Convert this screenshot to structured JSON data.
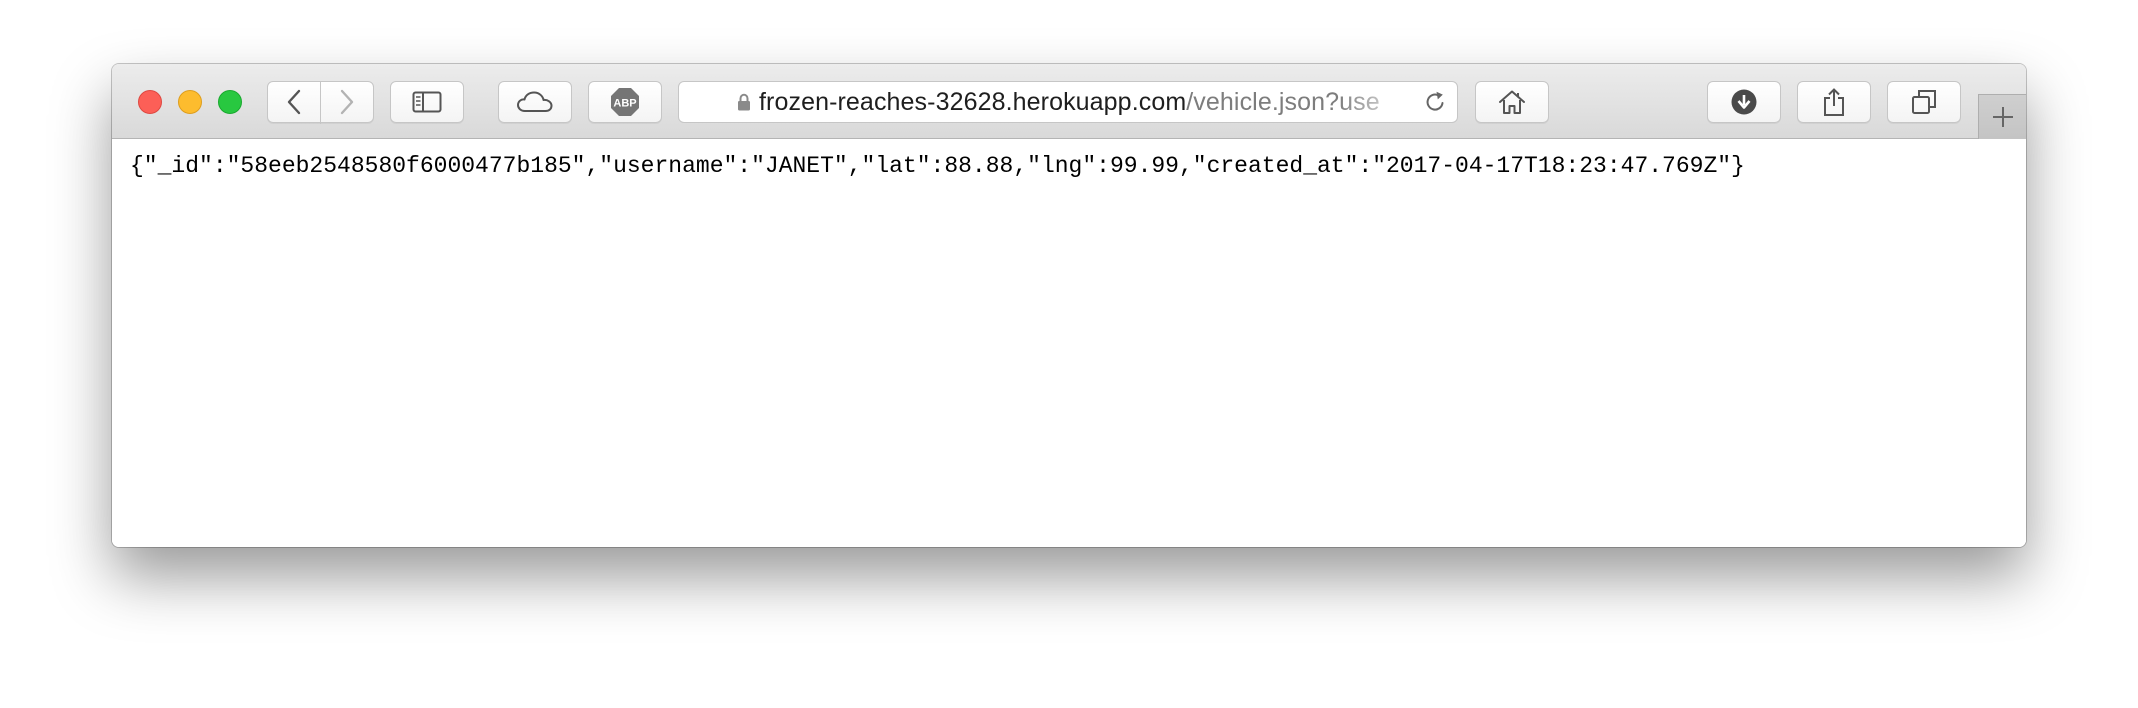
{
  "browser": {
    "url": {
      "host": "frozen-reaches-32628.herokuapp.com",
      "path": "/vehicle.json?use"
    },
    "toolbar": {
      "abp_label": "ABP"
    },
    "icons": [
      "close-window-light",
      "minimize-window-light",
      "zoom-window-light",
      "chevron-left-icon",
      "chevron-right-icon",
      "sidebar-icon",
      "cloud-icon",
      "abp-icon",
      "lock-icon",
      "reload-icon",
      "home-icon",
      "download-icon",
      "share-icon",
      "tabs-icon",
      "plus-icon"
    ],
    "colors": {
      "close": "#fc5f57",
      "minimize": "#fdbc2e",
      "zoom": "#28c840"
    }
  },
  "page": {
    "json_text": "{\"_id\":\"58eeb2548580f6000477b185\",\"username\":\"JANET\",\"lat\":88.88,\"lng\":99.99,\"created_at\":\"2017-04-17T18:23:47.769Z\"}"
  }
}
